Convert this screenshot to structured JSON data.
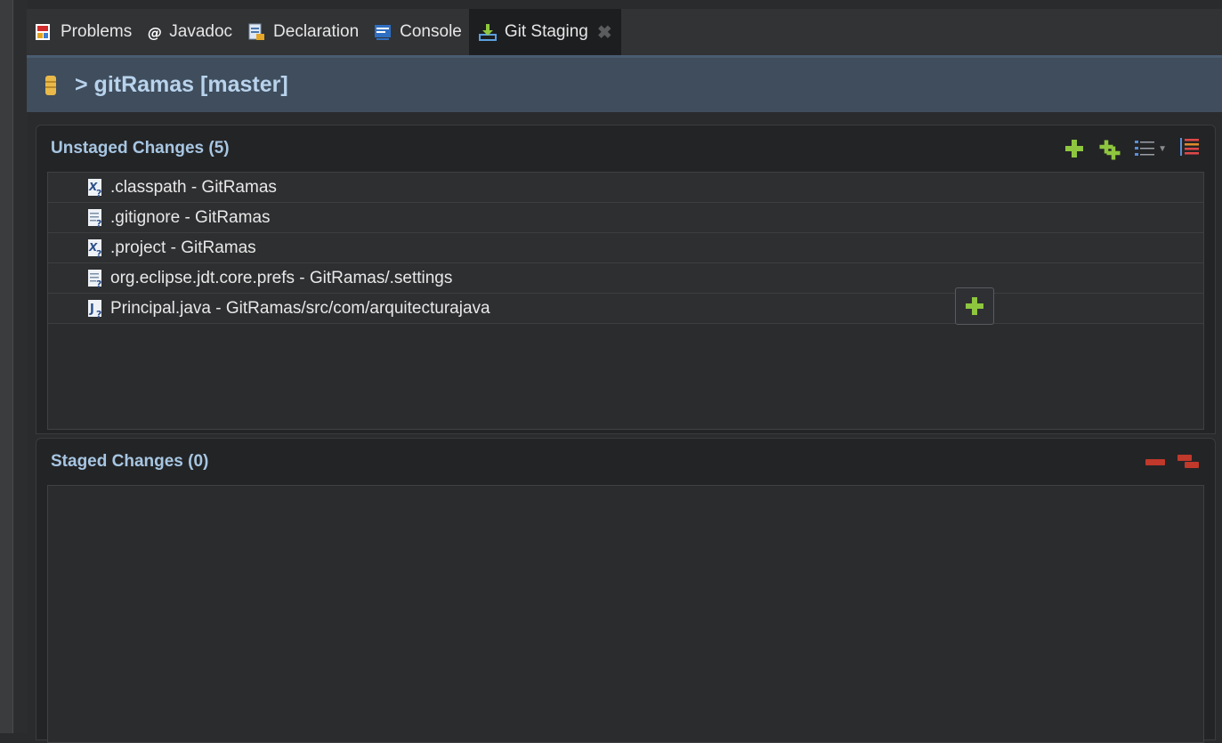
{
  "tabs": [
    {
      "label": "Problems",
      "icon": "problems-icon",
      "active": false
    },
    {
      "label": "Javadoc",
      "icon": "at-icon",
      "active": false
    },
    {
      "label": "Declaration",
      "icon": "declaration-icon",
      "active": false
    },
    {
      "label": "Console",
      "icon": "console-icon",
      "active": false
    },
    {
      "label": "Git Staging",
      "icon": "git-staging-icon",
      "active": true
    }
  ],
  "header": {
    "breadcrumb": "> gitRamas [master]"
  },
  "unstaged": {
    "title": "Unstaged Changes (5)",
    "files": [
      {
        "name": ".classpath - GitRamas",
        "icon": "xml-file-icon"
      },
      {
        "name": ".gitignore - GitRamas",
        "icon": "text-file-icon"
      },
      {
        "name": ".project - GitRamas",
        "icon": "xml-file-icon"
      },
      {
        "name": "org.eclipse.jdt.core.prefs - GitRamas/.settings",
        "icon": "text-file-icon"
      },
      {
        "name": "Principal.java - GitRamas/src/com/arquitecturajava",
        "icon": "java-file-icon"
      }
    ]
  },
  "staged": {
    "title": "Staged Changes (0)",
    "files": []
  },
  "colors": {
    "accent_green": "#8ec63f",
    "remove_red": "#c0392b",
    "header_blue": "#3f4d5d",
    "title_blue": "#a7c6e2"
  }
}
